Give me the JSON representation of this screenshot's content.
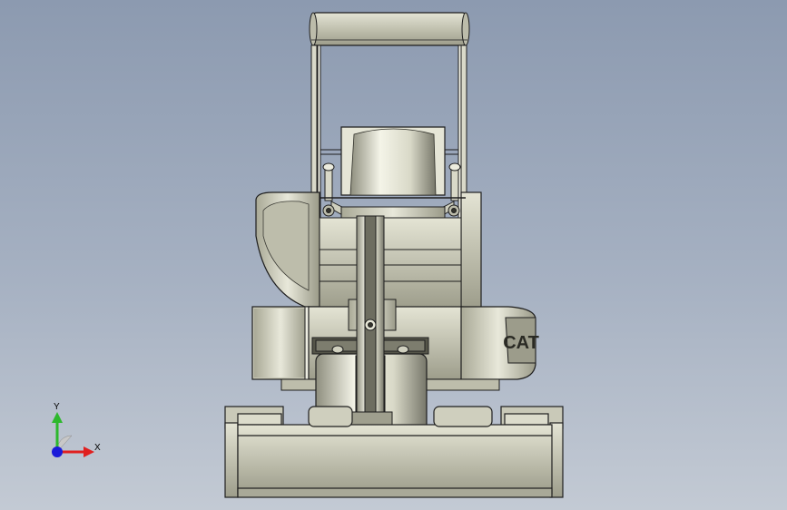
{
  "viewport": {
    "background_top": "#8c9ab0",
    "background_bottom": "#c3cad4"
  },
  "model": {
    "logo_text": "CAT",
    "shade_light": "#f2f2e6",
    "shade_mid": "#cfcfbe",
    "shade_dark": "#7d7d6e",
    "outline": "#1e1e1e",
    "track_color": "#a6a696"
  },
  "triad": {
    "y_label": "Y",
    "x_label": "X",
    "y_axis_color": "#2db82d",
    "x_axis_color": "#e02020",
    "z_axis_color": "#1a1ad9"
  }
}
